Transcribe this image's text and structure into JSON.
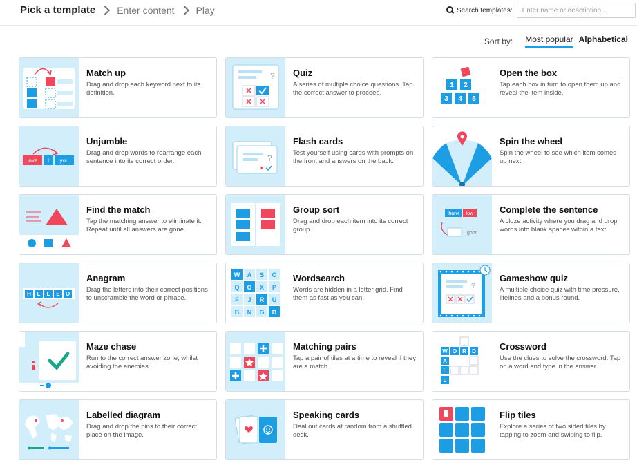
{
  "breadcrumb": {
    "steps": [
      "Pick a template",
      "Enter content",
      "Play"
    ]
  },
  "search": {
    "label": "Search templates:",
    "placeholder": "Enter name or description..."
  },
  "sort": {
    "label": "Sort by:",
    "options": [
      "Most popular",
      "Alphabetical"
    ],
    "selected": "Most popular"
  },
  "colors": {
    "accent": "#1aa0e6",
    "thumb_bg": "#d2eefb",
    "tile_blue": "#1d9ee4",
    "tile_red": "#f0475c"
  },
  "templates": [
    {
      "icon": "match-up-icon",
      "title": "Match up",
      "desc": "Drag and drop each keyword next to its definition."
    },
    {
      "icon": "quiz-icon",
      "title": "Quiz",
      "desc": "A series of multiple choice questions. Tap the correct answer to proceed."
    },
    {
      "icon": "open-the-box-icon",
      "title": "Open the box",
      "desc": "Tap each box in turn to open them up and reveal the item inside."
    },
    {
      "icon": "unjumble-icon",
      "title": "Unjumble",
      "desc": "Drag and drop words to rearrange each sentence into its correct order."
    },
    {
      "icon": "flash-cards-icon",
      "title": "Flash cards",
      "desc": "Test yourself using cards with prompts on the front and answers on the back."
    },
    {
      "icon": "spin-the-wheel-icon",
      "title": "Spin the wheel",
      "desc": "Spin the wheel to see which item comes up next."
    },
    {
      "icon": "find-the-match-icon",
      "title": "Find the match",
      "desc": "Tap the matching answer to eliminate it. Repeat until all answers are gone."
    },
    {
      "icon": "group-sort-icon",
      "title": "Group sort",
      "desc": "Drag and drop each item into its correct group."
    },
    {
      "icon": "complete-the-sentence-icon",
      "title": "Complete the sentence",
      "desc": "A cloze activity where you drag and drop words into blank spaces within a text."
    },
    {
      "icon": "anagram-icon",
      "title": "Anagram",
      "desc": "Drag the letters into their correct positions to unscramble the word or phrase."
    },
    {
      "icon": "wordsearch-icon",
      "title": "Wordsearch",
      "desc": "Words are hidden in a letter grid. Find them as fast as you can."
    },
    {
      "icon": "gameshow-quiz-icon",
      "title": "Gameshow quiz",
      "desc": "A multiple choice quiz with time pressure, lifelines and a bonus round."
    },
    {
      "icon": "maze-chase-icon",
      "title": "Maze chase",
      "desc": "Run to the correct answer zone, whilst avoiding the enemies."
    },
    {
      "icon": "matching-pairs-icon",
      "title": "Matching pairs",
      "desc": "Tap a pair of tiles at a time to reveal if they are a match."
    },
    {
      "icon": "crossword-icon",
      "title": "Crossword",
      "desc": "Use the clues to solve the crossword. Tap on a word and type in the answer."
    },
    {
      "icon": "labelled-diagram-icon",
      "title": "Labelled diagram",
      "desc": "Drag and drop the pins to their correct place on the image."
    },
    {
      "icon": "speaking-cards-icon",
      "title": "Speaking cards",
      "desc": "Deal out cards at random from a shuffled deck."
    },
    {
      "icon": "flip-tiles-icon",
      "title": "Flip tiles",
      "desc": "Explore a series of two sided tiles by tapping to zoom and swiping to flip."
    }
  ],
  "thumb_text": {
    "unjumble": [
      "love",
      "I",
      "you"
    ],
    "anagram": [
      "H",
      "L",
      "L",
      "E",
      "O"
    ],
    "wordsearch": [
      "W",
      "A",
      "S",
      "O",
      "Q",
      "O",
      "X",
      "P",
      "F",
      "J",
      "R",
      "U",
      "B",
      "N",
      "G",
      "D"
    ],
    "complete": [
      "thank",
      "low",
      "good"
    ],
    "crossword": [
      "W",
      "O",
      "R",
      "D",
      "A",
      "L",
      "L"
    ]
  }
}
